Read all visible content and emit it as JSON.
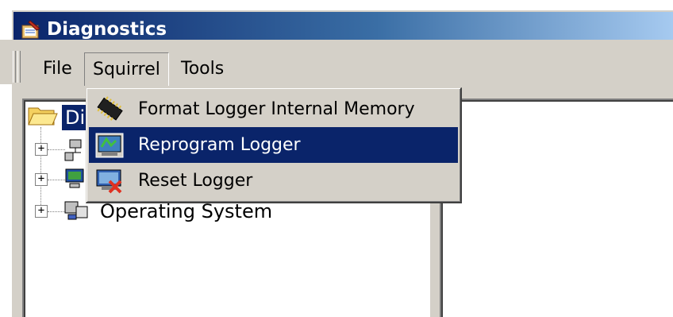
{
  "window": {
    "title": "Diagnostics",
    "title_icon": "diagnostics-app-icon"
  },
  "menubar": {
    "items": [
      "File",
      "Squirrel",
      "Tools"
    ],
    "open_menu": "Squirrel"
  },
  "tree": {
    "root": {
      "label": "Di",
      "icon": "folder-open-icon",
      "selected": true
    },
    "children": [
      {
        "label": "",
        "icon": "network-icon",
        "expander": "+"
      },
      {
        "label": "",
        "icon": "computer-icon",
        "expander": "+"
      },
      {
        "label": "Operating System",
        "icon": "operating-system-icon",
        "expander": "+"
      }
    ]
  },
  "dropdown": {
    "items": [
      {
        "label": "Format Logger Internal Memory",
        "icon": "memory-chip-icon",
        "selected": false
      },
      {
        "label": "Reprogram Logger",
        "icon": "reprogram-icon",
        "selected": true
      },
      {
        "label": "Reset Logger",
        "icon": "reset-logger-icon",
        "selected": false
      }
    ]
  },
  "colors": {
    "selection": "#0a246a",
    "face": "#d4d0c8",
    "title_gradient_start": "#0a246a",
    "title_gradient_end": "#a6caf0"
  }
}
